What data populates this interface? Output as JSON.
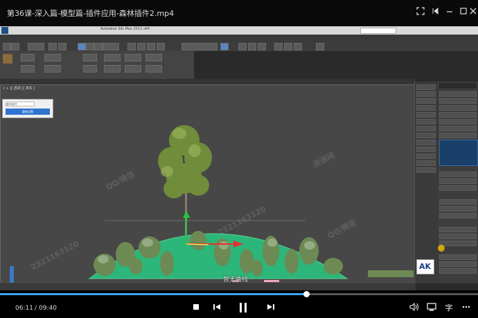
{
  "player": {
    "title": "第36课-深入篇-模型篇-插件应用-森林插件2.mp4",
    "time_current": "06:11",
    "time_separator": "/",
    "time_total": "09:40",
    "progress": 0.64,
    "buffered": 0.64,
    "caption": "暂无曲线",
    "right_label_subtitle": "字"
  },
  "app": {
    "window_title": "Autodesk 3ds Max 2012 x64",
    "viewport_label": "[ + ][ 透视 ][ 真实 ]",
    "popup_field_text": "森林插件",
    "popup_button": "重新设置",
    "watermark_a": "QQ/微信",
    "watermark_b": "2321163120",
    "watermark_c": "资源网",
    "logo_text": "AK"
  },
  "colors": {
    "accent": "#3ea5ff",
    "popup_button": "#2f74d0",
    "ground": "#2db679",
    "gizmo_red": "#e53030",
    "gizmo_green": "#22cc44"
  },
  "icons": {
    "fullscreen_exit": "fullscreen-exit-icon",
    "picture_in_picture": "pip-icon",
    "minimize": "minimize-icon",
    "maximize": "maximize-icon",
    "close": "close-icon",
    "stop": "stop-icon",
    "prev": "previous-icon",
    "pause": "pause-icon",
    "next": "next-icon",
    "volume": "volume-icon",
    "screen": "screen-mode-icon",
    "more": "more-icon"
  }
}
